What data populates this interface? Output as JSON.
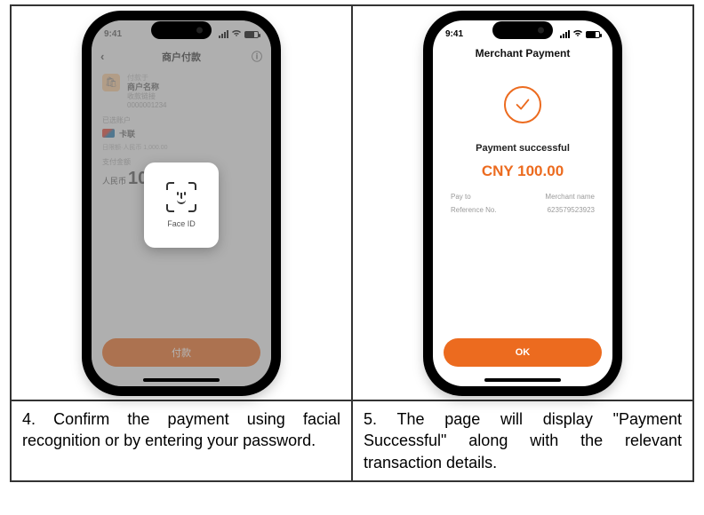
{
  "step4": {
    "caption": "4. Confirm the payment using facial recognition or by entering your password.",
    "statusbar_time": "9:41",
    "header_title": "商户付款",
    "pay_to_label": "付款于",
    "merchant_name": "商户名称",
    "merchant_desc": "收款链接",
    "merchant_ref": "0000001234",
    "account_section": "已选账户",
    "card_name": "卡联",
    "limit_text": "日限额·人民币 1,000.00",
    "amount_label": "支付金额",
    "amount_prefix": "人民币",
    "amount_value": "100",
    "faceid_label": "Face ID",
    "pay_button": "付款"
  },
  "step5": {
    "caption": "5. The page will display \"Payment Successful\" along with the relevant transaction details.",
    "statusbar_time": "9:41",
    "header_title": "Merchant Payment",
    "success_text": "Payment successful",
    "amount": "CNY 100.00",
    "payto_label": "Pay to",
    "payto_value": "Merchant name",
    "ref_label": "Reference No.",
    "ref_value": "623579523923",
    "ok_button": "OK"
  }
}
